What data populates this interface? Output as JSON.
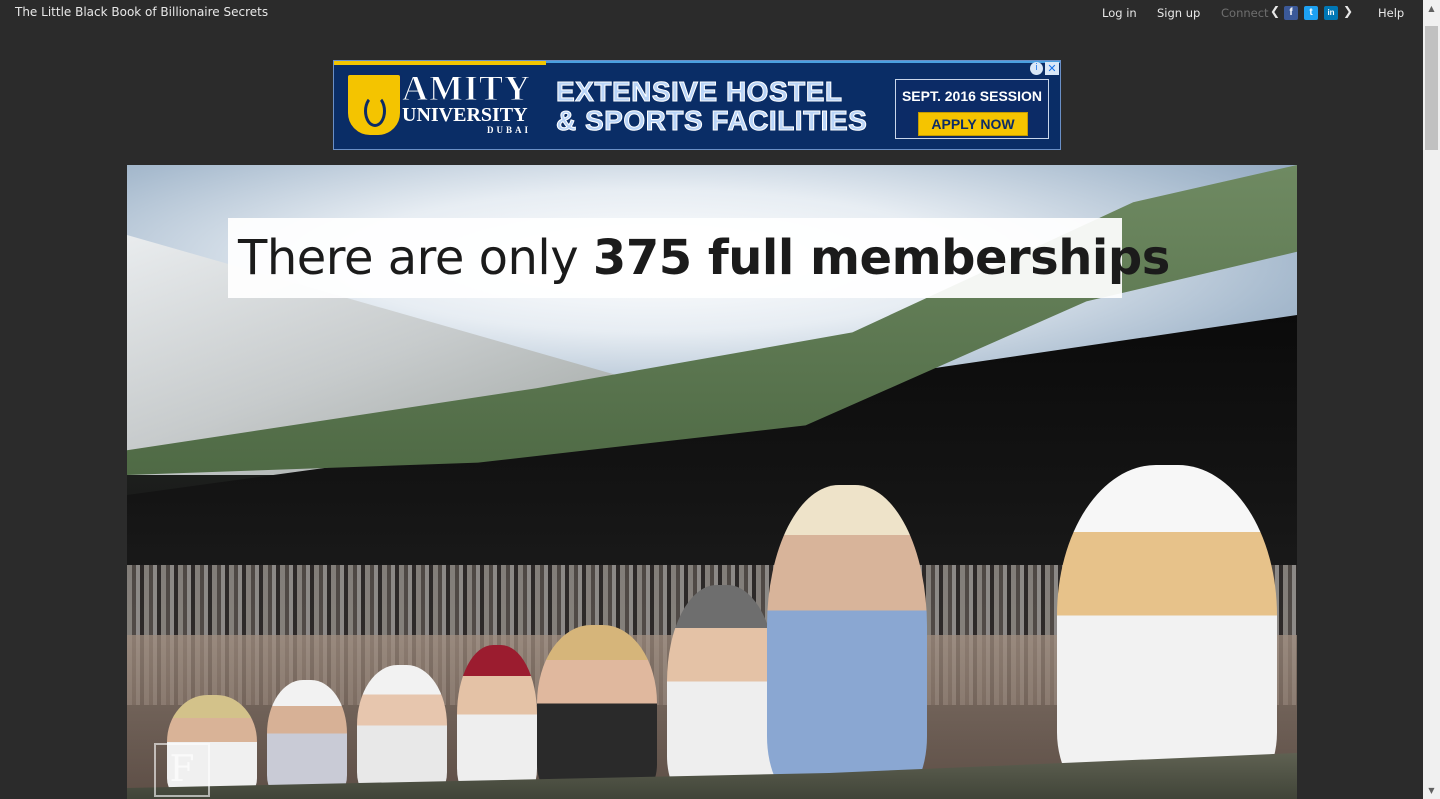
{
  "header": {
    "site_title": "The Little Black Book of Billionaire Secrets",
    "login_label": "Log in",
    "signup_label": "Sign up",
    "connect_label": "Connect",
    "help_label": "Help",
    "social_icons": [
      "facebook-icon",
      "twitter-icon",
      "linkedin-icon"
    ],
    "social_glyphs": {
      "facebook": "f",
      "twitter": "t",
      "linkedin": "in"
    }
  },
  "ad": {
    "brand_line1": "AMITY",
    "brand_line2": "UNIVERSITY",
    "brand_line3": "DUBAI",
    "headline_line1": "EXTENSIVE HOSTEL",
    "headline_line2": "& SPORTS FACILITIES",
    "session": "SEPT. 2016 SESSION",
    "cta": "APPLY NOW",
    "colors": {
      "navy": "#0a2d66",
      "gold": "#f5c400"
    }
  },
  "video": {
    "caption_regular": "There are only ",
    "caption_bold": "375 full memberships",
    "watermark": "F"
  }
}
